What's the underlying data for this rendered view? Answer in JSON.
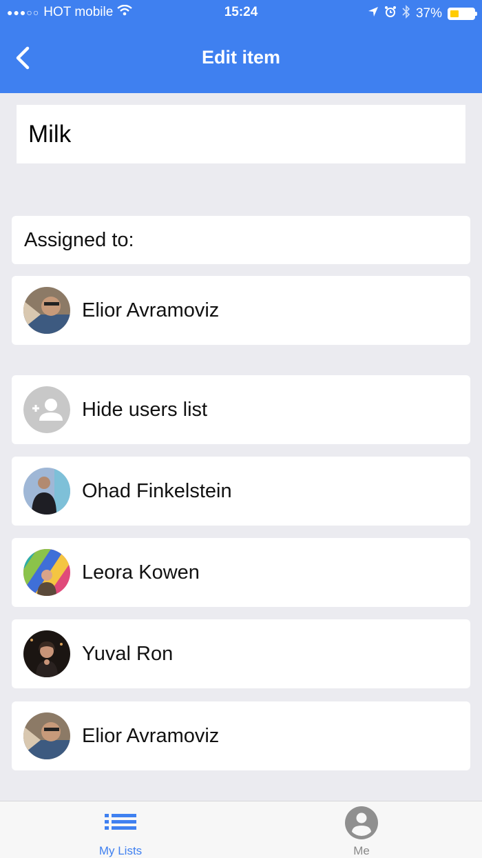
{
  "status_bar": {
    "carrier": "HOT mobile",
    "time": "15:24",
    "battery": "37%",
    "battery_level": 0.37
  },
  "header": {
    "title": "Edit item",
    "back_icon": "chevron-left-icon"
  },
  "item": {
    "name": "Milk"
  },
  "assigned": {
    "header": "Assigned to:",
    "users": [
      {
        "name": "Elior Avramoviz"
      }
    ]
  },
  "users_list": {
    "toggle_label": "Hide users list",
    "toggle_icon": "add-user-icon",
    "users": [
      {
        "name": "Ohad Finkelstein"
      },
      {
        "name": "Leora Kowen"
      },
      {
        "name": "Yuval Ron"
      },
      {
        "name": "Elior Avramoviz"
      }
    ]
  },
  "tabbar": {
    "tabs": [
      {
        "label": "My Lists",
        "icon": "list-icon",
        "active": true
      },
      {
        "label": "Me",
        "icon": "account-icon",
        "active": false
      }
    ]
  },
  "colors": {
    "accent": "#3f80f0",
    "background": "#ebebf0",
    "battery": "#ffcc00"
  }
}
